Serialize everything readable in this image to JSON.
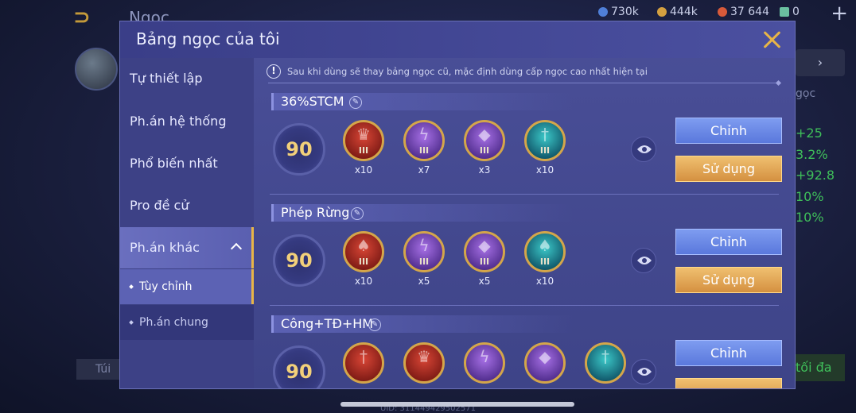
{
  "background": {
    "title": "Ngọc",
    "currencies": [
      {
        "value": "730k",
        "color": "#4f7fd8",
        "icon": "diamond-icon"
      },
      {
        "value": "444k",
        "color": "#d4a040",
        "icon": "gold-coin-icon"
      },
      {
        "value": "37 644",
        "color": "#d85a3a",
        "icon": "ruby-icon"
      },
      {
        "value": "0",
        "color": "#6ac0a0",
        "icon": "voucher-icon"
      }
    ],
    "right_label": "gọc",
    "stats": [
      "+25",
      "3.2%",
      "+92.8",
      "10%",
      "10%"
    ],
    "left_button": "Túi",
    "bottom_button": "tối đa",
    "uid": "UID: 311449429502571"
  },
  "modal": {
    "title": "Bảng ngọc của tôi",
    "notice": "Sau khi dùng sẽ thay bảng ngọc cũ, mặc định dùng cấp ngọc cao nhất hiện tại"
  },
  "sidebar": {
    "items": [
      {
        "label": "Tự thiết lập"
      },
      {
        "label": "Ph.án hệ thống"
      },
      {
        "label": "Phổ biến nhất"
      },
      {
        "label": "Pro đề cử"
      },
      {
        "label": "Ph.án khác"
      }
    ],
    "sub_items": [
      {
        "label": "Tùy chỉnh"
      },
      {
        "label": "Ph.án chung"
      }
    ]
  },
  "pages": [
    {
      "name": "36%STCM",
      "level": "90",
      "runes": [
        {
          "color": "red",
          "tier": "III",
          "count": "x10",
          "icon": "red-crown-rune-icon"
        },
        {
          "color": "purple",
          "tier": "III",
          "count": "x7",
          "icon": "purple-lightning-rune-icon"
        },
        {
          "color": "purple",
          "tier": "III",
          "count": "x3",
          "icon": "purple-drop-rune-icon"
        },
        {
          "color": "teal",
          "tier": "III",
          "count": "x10",
          "icon": "teal-sword-rune-icon"
        }
      ],
      "edit_label": "Chỉnh",
      "use_label": "Sử dụng"
    },
    {
      "name": "Phép Rừng",
      "level": "90",
      "runes": [
        {
          "color": "red",
          "tier": "III",
          "count": "x10",
          "icon": "red-flame-rune-icon"
        },
        {
          "color": "purple",
          "tier": "III",
          "count": "x5",
          "icon": "purple-lightning-rune-icon"
        },
        {
          "color": "purple",
          "tier": "III",
          "count": "x5",
          "icon": "purple-drop-rune-icon"
        },
        {
          "color": "teal",
          "tier": "III",
          "count": "x10",
          "icon": "teal-flame-rune-icon"
        }
      ],
      "edit_label": "Chỉnh",
      "use_label": "Sử dụng"
    },
    {
      "name": "Công+TĐ+HM",
      "level": "90",
      "runes": [
        {
          "color": "red",
          "tier": "",
          "count": "",
          "icon": "red-sword-rune-icon"
        },
        {
          "color": "red",
          "tier": "",
          "count": "",
          "icon": "red-crown-rune-icon"
        },
        {
          "color": "purple",
          "tier": "",
          "count": "",
          "icon": "purple-lightning-rune-icon"
        },
        {
          "color": "purple",
          "tier": "",
          "count": "",
          "icon": "purple-drop-rune-icon"
        },
        {
          "color": "teal",
          "tier": "",
          "count": "",
          "icon": "teal-sword-rune-icon"
        }
      ],
      "edit_label": "Chỉnh",
      "use_label": ""
    }
  ]
}
